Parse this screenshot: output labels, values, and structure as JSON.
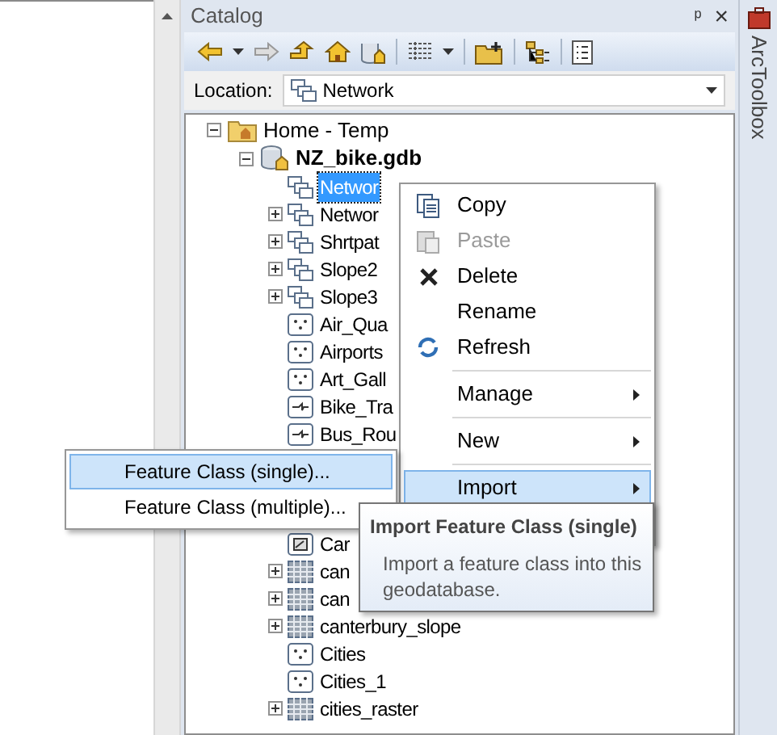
{
  "panel": {
    "title": "Catalog",
    "pin": "ᵖ",
    "close": "×"
  },
  "location": {
    "label": "Location:",
    "value": "Network"
  },
  "tree": {
    "label": "Home - Temp",
    "expanded": true,
    "children": [
      {
        "label": "NZ_bike.gdb",
        "expanded": true,
        "children": [
          {
            "label": "Networ",
            "kind": "network",
            "expandable": false,
            "selected": true
          },
          {
            "label": "Networ",
            "kind": "network",
            "expandable": true,
            "selected": false
          },
          {
            "label": "Shrtpat",
            "kind": "network",
            "expandable": true,
            "selected": false
          },
          {
            "label": "Slope2",
            "kind": "network",
            "expandable": true,
            "selected": false
          },
          {
            "label": "Slope3",
            "kind": "network",
            "expandable": true,
            "selected": false
          },
          {
            "label": "Air_Qua",
            "kind": "point",
            "expandable": false,
            "selected": false
          },
          {
            "label": "Airports",
            "kind": "point",
            "expandable": false,
            "selected": false
          },
          {
            "label": "Art_Gall",
            "kind": "point",
            "expandable": false,
            "selected": false
          },
          {
            "label": "Bike_Tra",
            "kind": "line",
            "expandable": false,
            "selected": false
          },
          {
            "label": "Bus_Rou",
            "kind": "line",
            "expandable": false,
            "selected": false
          },
          {
            "label": "Car",
            "kind": "polygon",
            "expandable": false,
            "selected": false
          },
          {
            "label": "can",
            "kind": "raster",
            "expandable": true,
            "selected": false
          },
          {
            "label": "can",
            "kind": "raster",
            "expandable": true,
            "selected": false
          },
          {
            "label": "canterbury_slope",
            "kind": "raster",
            "expandable": true,
            "selected": false
          },
          {
            "label": "Cities",
            "kind": "point",
            "expandable": false,
            "selected": false
          },
          {
            "label": "Cities_1",
            "kind": "point",
            "expandable": false,
            "selected": false
          },
          {
            "label": "cities_raster",
            "kind": "raster",
            "expandable": true,
            "selected": false
          }
        ]
      }
    ]
  },
  "context_menu": [
    {
      "kind": "item",
      "label": "Copy",
      "disabled": false,
      "submenu": false,
      "selected": false
    },
    {
      "kind": "item",
      "label": "Paste",
      "disabled": true,
      "submenu": false,
      "selected": false
    },
    {
      "kind": "item",
      "label": "Delete",
      "disabled": false,
      "submenu": false,
      "selected": false
    },
    {
      "kind": "item",
      "label": "Rename",
      "disabled": false,
      "submenu": false,
      "selected": false
    },
    {
      "kind": "item",
      "label": "Refresh",
      "disabled": false,
      "submenu": false,
      "selected": false
    },
    {
      "kind": "separator"
    },
    {
      "kind": "item",
      "label": "Manage",
      "disabled": false,
      "submenu": true,
      "selected": false
    },
    {
      "kind": "separator"
    },
    {
      "kind": "item",
      "label": "New",
      "disabled": false,
      "submenu": true,
      "selected": false
    },
    {
      "kind": "separator"
    },
    {
      "kind": "item",
      "label": "Import",
      "disabled": false,
      "submenu": true,
      "selected": true
    }
  ],
  "submenu": [
    {
      "label": "Feature Class (single)...",
      "selected": true
    },
    {
      "label": "Feature Class (multiple)...",
      "selected": false
    }
  ],
  "tooltip": {
    "title": "Import Feature Class (single)",
    "text": "Import a feature class into this geodatabase."
  },
  "side_tab": {
    "label": "ArcToolbox"
  }
}
